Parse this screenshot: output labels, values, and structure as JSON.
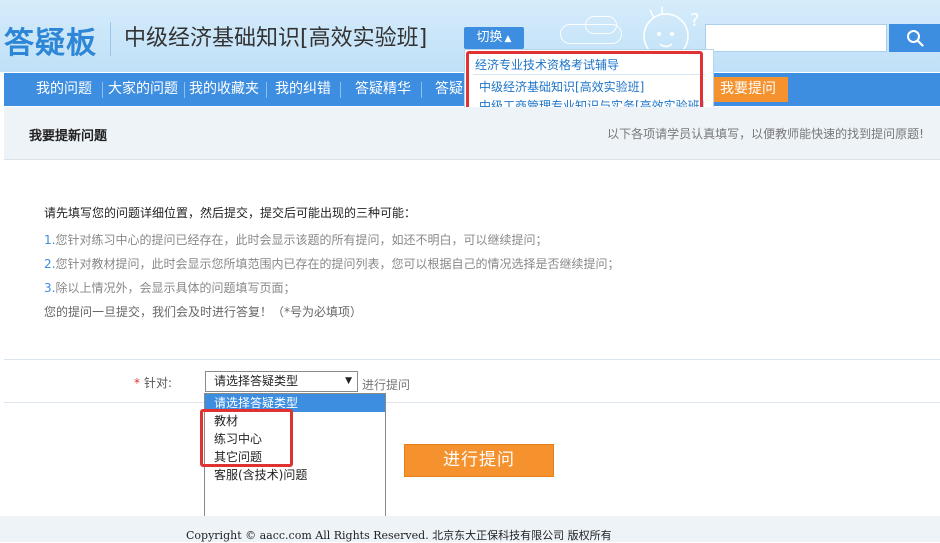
{
  "header": {
    "logo": "答疑板",
    "course_title": "中级经济基础知识[高效实验班]",
    "switch_label": "切换",
    "search_placeholder": "",
    "search_icon": "search-icon",
    "mascot_question": "?"
  },
  "nav": {
    "items": [
      {
        "label": "我的问题"
      },
      {
        "label": "大家的问题"
      },
      {
        "label": "我的收藏夹"
      },
      {
        "label": "我的纠错"
      },
      {
        "label": "答疑精华"
      },
      {
        "label": "答疑"
      }
    ],
    "ask_label": "我要提问"
  },
  "switch_panel": {
    "group": "经济专业技术资格考试辅导",
    "links": [
      {
        "label": "中级经济基础知识[高效实验班]"
      },
      {
        "label": "中级工商管理专业知识与实务[高效实验班]"
      }
    ]
  },
  "subhead": {
    "title": "我要提新问题",
    "hint": "以下各项请学员认真填写，以便教师能快速的找到提问原题!"
  },
  "instructions": {
    "title": "请先填写您的问题详细位置，然后提交，提交后可能出现的三种可能：",
    "lines": [
      {
        "num": "1.",
        "text": "您针对练习中心的提问已经存在，此时会显示该题的所有提问，如还不明白，可以继续提问；"
      },
      {
        "num": "2.",
        "text": "您针对教材提问，此时会显示您所填范围内已存在的提问列表，您可以根据自己的情况选择是否继续提问；"
      },
      {
        "num": "3.",
        "text": "除以上情况外，会显示具体的问题填写页面；"
      }
    ],
    "note": "您的提问一旦提交，我们会及时进行答复！（*号为必填项）"
  },
  "form": {
    "required_mark": "*",
    "label": "针对:",
    "select_value": "请选择答疑类型",
    "select_hint": "进行提问",
    "options": [
      {
        "label": "请选择答疑类型",
        "selected": true
      },
      {
        "label": "教材"
      },
      {
        "label": "练习中心"
      },
      {
        "label": "其它问题"
      },
      {
        "label": "客服(含技术)问题"
      }
    ]
  },
  "submit": {
    "label": "进行提问"
  },
  "footer": {
    "text": "Copyright ©         aacc.com All Rights Reserved.  北京东大正保科技有限公司 版权所有"
  },
  "colors": {
    "brand_blue": "#3d8ee0",
    "accent_orange": "#f5922e",
    "highlight_red": "#e03232"
  }
}
